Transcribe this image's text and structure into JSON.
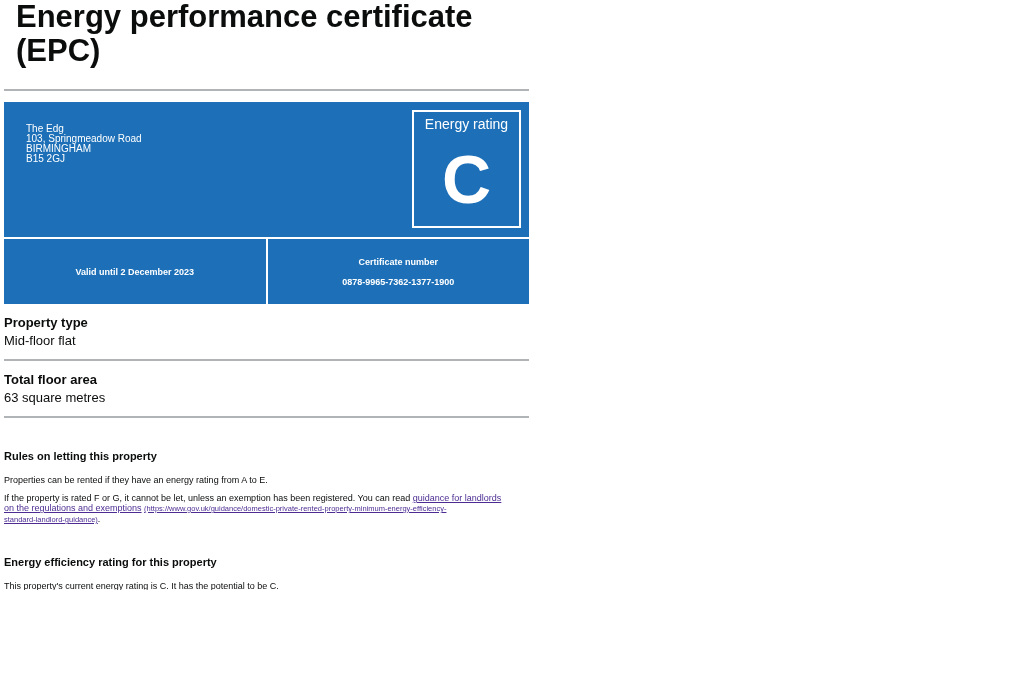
{
  "title": "Energy performance certificate (EPC)",
  "address": [
    "The Edg",
    "103, Springmeadow Road",
    "BIRMINGHAM",
    "B15 2GJ"
  ],
  "rating": {
    "label": "Energy rating",
    "letter": "C"
  },
  "valid_until": "Valid until 2 December 2023",
  "certificate": {
    "label": "Certificate number",
    "number": "0878-9965-7362-1377-1900"
  },
  "summary": [
    {
      "label": "Property type",
      "value": "Mid-floor flat"
    },
    {
      "label": "Total floor area",
      "value": "63 square metres"
    }
  ],
  "letting": {
    "heading": "Rules on letting this property",
    "paragraph": "Properties can be rented if they have an energy rating from A to E.",
    "paragraph_2": "If the property is rated F or G, it cannot be let, unless an exemption has been registered. You can read ",
    "links": [
      "guidance for landlords",
      "on the regulations and exemptions"
    ],
    "link_url": [
      "(https://www.gov.uk/guidance/domestic-private-rented-property-minimum-energy-efficiency-",
      "standard-landlord-guidance)"
    ],
    "after_link": "."
  },
  "efficiency": {
    "heading": "Energy efficiency rating for this property",
    "paragraph": "This property's current energy rating is C. It has the potential to be C."
  }
}
